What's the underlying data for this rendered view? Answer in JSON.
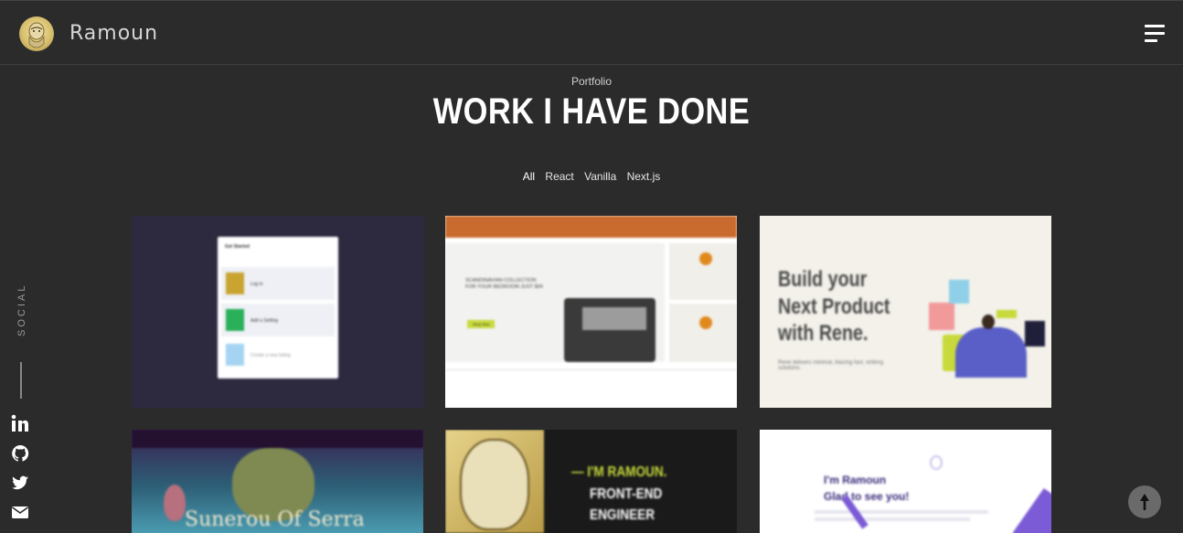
{
  "header": {
    "brand": "Ramoun",
    "menu_icon": "hamburger-icon",
    "avatar_icon": "portrait-avatar"
  },
  "section": {
    "kicker": "Portfolio",
    "title": "WORK I HAVE DONE",
    "filters": [
      "All",
      "React",
      "Vanilla",
      "Next.js"
    ],
    "active_filter": "All"
  },
  "projects": [
    {
      "panel_title": "Get Started",
      "items": [
        "Log in",
        "Add a Setting",
        "Create a new listing"
      ]
    },
    {
      "headline": "SCANDINAVIAN COLLECTION FOR YOUR BEDROOM JUST $99",
      "badge": "Shop Now"
    },
    {
      "headline_1": "Build your",
      "headline_2": "Next Product",
      "headline_3": "with Rene.",
      "sub": "Rene delivers minimal, blazing fast, striking solutions."
    },
    {
      "caption": "Sunerou Of Serra"
    },
    {
      "line_1": "— I'M RAMOUN.",
      "line_2": "FRONT-END",
      "line_3": "ENGINEER"
    },
    {
      "line_1": "I'm Ramoun",
      "line_2": "Glad to see you!"
    }
  ],
  "social": {
    "label": "SOCIAL",
    "icons": [
      "linkedin-icon",
      "github-icon",
      "twitter-icon",
      "email-icon"
    ]
  },
  "scroll_top_icon": "arrow-up-icon",
  "colors": {
    "background": "#2b2b2b",
    "accent_green": "#c7d93b",
    "accent_purple": "#7b5bd6",
    "orange_bar": "#c96a2e"
  }
}
